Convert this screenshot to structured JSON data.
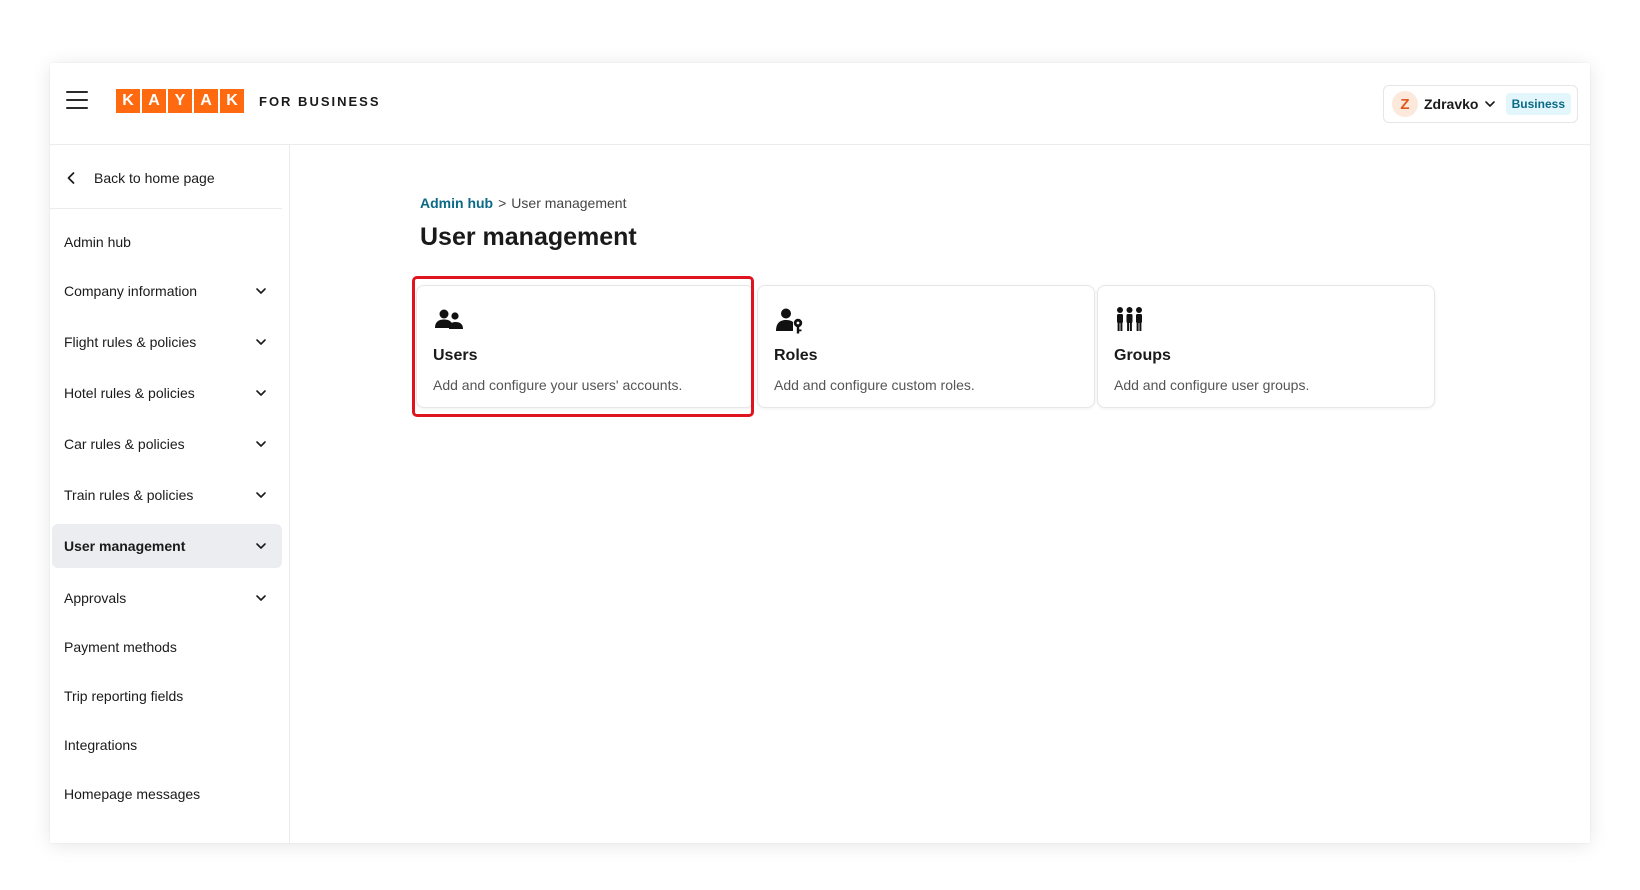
{
  "header": {
    "logo_letters": [
      "K",
      "A",
      "Y",
      "A",
      "K"
    ],
    "brand_suffix": "FOR BUSINESS",
    "user": {
      "initial": "Z",
      "name": "Zdravko",
      "plan_badge": "Business"
    }
  },
  "sidebar": {
    "back_label": "Back to home page",
    "items": [
      {
        "label": "Admin hub",
        "expandable": false,
        "active": false
      },
      {
        "label": "Company information",
        "expandable": true,
        "active": false
      },
      {
        "label": "Flight rules & policies",
        "expandable": true,
        "active": false
      },
      {
        "label": "Hotel rules & policies",
        "expandable": true,
        "active": false
      },
      {
        "label": "Car rules & policies",
        "expandable": true,
        "active": false
      },
      {
        "label": "Train rules & policies",
        "expandable": true,
        "active": false
      },
      {
        "label": "User management",
        "expandable": true,
        "active": true
      },
      {
        "label": "Approvals",
        "expandable": true,
        "active": false
      },
      {
        "label": "Payment methods",
        "expandable": false,
        "active": false
      },
      {
        "label": "Trip reporting fields",
        "expandable": false,
        "active": false
      },
      {
        "label": "Integrations",
        "expandable": false,
        "active": false
      },
      {
        "label": "Homepage messages",
        "expandable": false,
        "active": false
      }
    ]
  },
  "main": {
    "breadcrumb": {
      "parent": "Admin hub",
      "separator": ">",
      "current": "User management"
    },
    "title": "User management",
    "cards": [
      {
        "icon": "users-icon",
        "title": "Users",
        "description": "Add and configure your users' accounts.",
        "highlighted": true
      },
      {
        "icon": "user-key-icon",
        "title": "Roles",
        "description": "Add and configure custom roles.",
        "highlighted": false
      },
      {
        "icon": "group-icon",
        "title": "Groups",
        "description": "Add and configure user groups.",
        "highlighted": false
      }
    ]
  },
  "colors": {
    "brand": "#ff690f",
    "link": "#0b6a86",
    "badge_bg": "#e3f6fb",
    "highlight": "#e0141f",
    "active_nav_bg": "#ebedf0"
  }
}
